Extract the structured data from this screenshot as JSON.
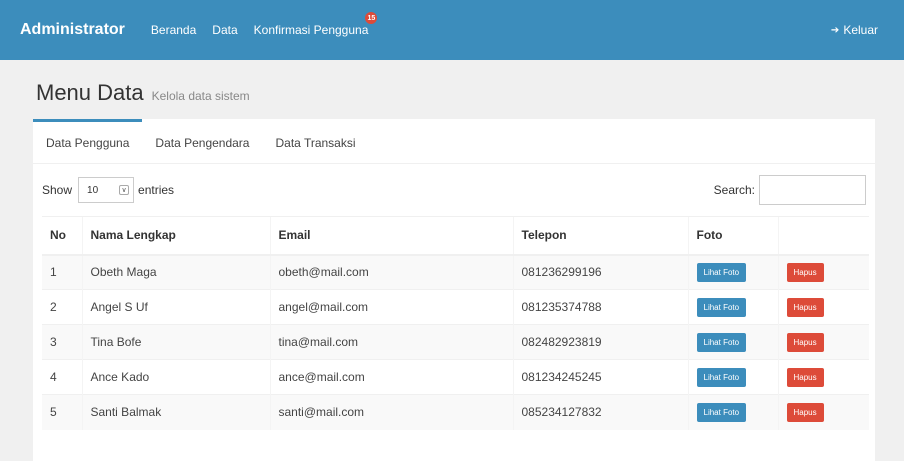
{
  "navbar": {
    "brand": "Administrator",
    "items": [
      {
        "label": "Beranda"
      },
      {
        "label": "Data"
      },
      {
        "label": "Konfirmasi Pengguna",
        "badge": "15"
      }
    ],
    "logout": "Keluar",
    "logout_icon": "sign-out-icon",
    "color": "#3c8dbc"
  },
  "header": {
    "title": "Menu Data",
    "subtitle": "Kelola data sistem"
  },
  "tabs": [
    {
      "label": "Data Pengguna"
    },
    {
      "label": "Data Pengendara"
    },
    {
      "label": "Data Transaksi"
    }
  ],
  "table_controls": {
    "show_label": "Show",
    "entries_value": "10",
    "entries_label": "entries",
    "search_label": "Search:",
    "search_value": ""
  },
  "table": {
    "columns": [
      "No",
      "Nama Lengkap",
      "Email",
      "Telepon",
      "Foto",
      ""
    ],
    "rows": [
      {
        "no": "1",
        "name": "Obeth Maga",
        "email": "obeth@mail.com",
        "phone": "081236299196"
      },
      {
        "no": "2",
        "name": "Angel S Uf",
        "email": "angel@mail.com",
        "phone": "081235374788"
      },
      {
        "no": "3",
        "name": "Tina Bofe",
        "email": "tina@mail.com",
        "phone": "082482923819"
      },
      {
        "no": "4",
        "name": "Ance Kado",
        "email": "ance@mail.com",
        "phone": "081234245245"
      },
      {
        "no": "5",
        "name": "Santi Balmak",
        "email": "santi@mail.com",
        "phone": "085234127832"
      }
    ],
    "view_button": "Lihat Foto",
    "delete_button": "Hapus",
    "view_color": "#3c8dbc",
    "delete_color": "#dd4b39"
  }
}
